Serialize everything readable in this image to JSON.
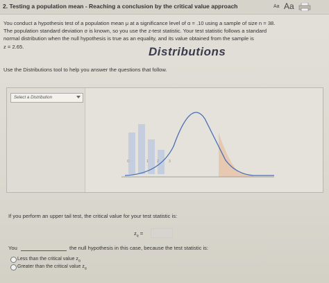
{
  "header": {
    "title": "2. Testing a population mean - Reaching a conclusion by the critical value approach",
    "font_small": "Aa",
    "font_large": "Aa"
  },
  "problem": {
    "line1": "You conduct a hypothesis test of a population mean μ at a significance level of α = .10 using a sample of size n = 38.",
    "line2": "The population standard deviation σ is known, so you use the z-test statistic. Your test statistic follows a standard",
    "line3": "normal distribution when the null hypothesis is true as an equality, and its value obtained from the sample is",
    "line4": "z = 2.65."
  },
  "instruction": "Use the Distributions tool to help you answer the questions that follow.",
  "tool": {
    "select_placeholder": "Select a Distribution",
    "overlay_label": "Distributions",
    "tick_labels": [
      "0",
      "1",
      "2",
      "3"
    ]
  },
  "question1": "If you perform an upper tail test, the critical value for your test statistic is:",
  "z_label": "z",
  "z_subscript": "α",
  "z_equals": " =",
  "row": {
    "you": "You",
    "rest": "the null hypothesis in this case, because the test statistic is:"
  },
  "options": [
    {
      "text": "Less than the critical value z",
      "sub": "α"
    },
    {
      "text": "Greater than the critical value z",
      "sub": "α"
    }
  ],
  "colors": {
    "accent_orange": "#e8b58c",
    "bar_blue": "#b8c6e0",
    "curve_blue": "#4a6fb5"
  }
}
